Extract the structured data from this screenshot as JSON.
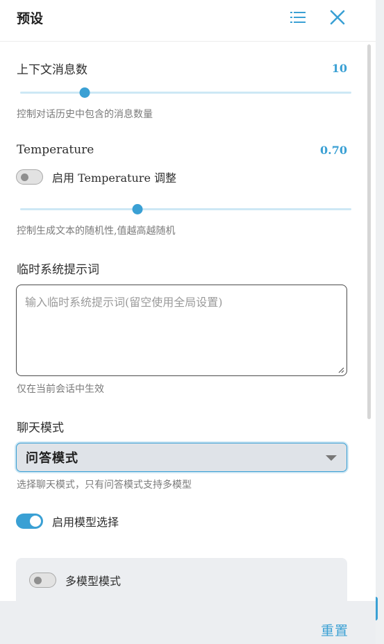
{
  "header": {
    "title": "预设"
  },
  "context": {
    "label": "上下文消息数",
    "value": "10",
    "slider_fraction": 0.195,
    "hint": "控制对话历史中包含的消息数量"
  },
  "temperature": {
    "label": "Temperature",
    "value": "0.70",
    "toggle_label": "启用 Temperature 调整",
    "toggle_on": false,
    "slider_fraction": 0.355,
    "hint": "控制生成文本的随机性,值越高越随机"
  },
  "system_prompt": {
    "label": "临时系统提示词",
    "placeholder": "输入临时系统提示词(留空使用全局设置)",
    "hint": "仅在当前会话中生效"
  },
  "chat_mode": {
    "label": "聊天模式",
    "selected": "问答模式",
    "hint": "选择聊天模式，只有问答模式支持多模型"
  },
  "model_select": {
    "toggle_label": "启用模型选择",
    "toggle_on": true
  },
  "multi_model": {
    "toggle_label": "多模型模式",
    "toggle_on": false
  },
  "footer": {
    "reset_label": "重置"
  },
  "colors": {
    "accent": "#3aa0d4",
    "track": "#cde8f5",
    "footer_bg": "#eceef1"
  },
  "icons": {
    "menu": "list-icon",
    "close": "close-icon",
    "caret": "chevron-down-icon"
  }
}
